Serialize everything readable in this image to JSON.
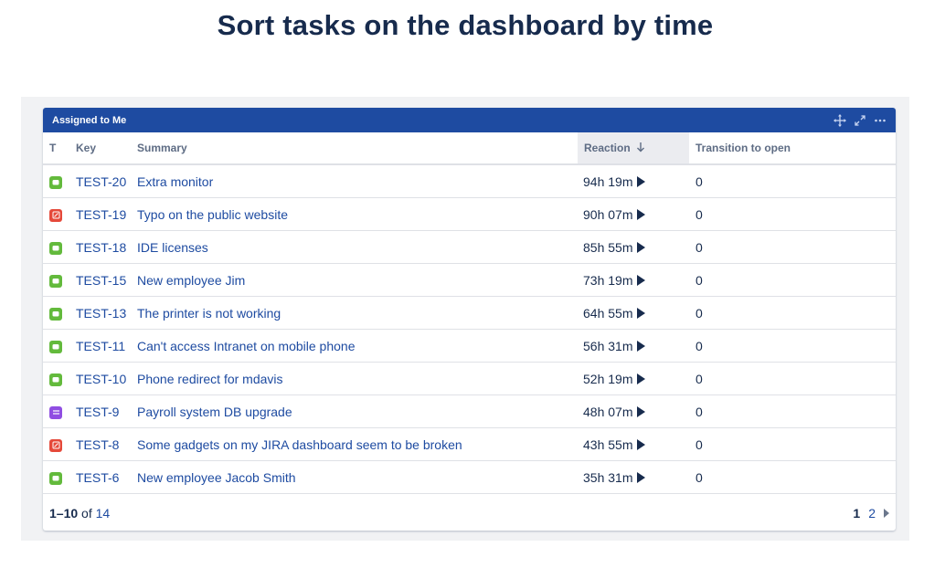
{
  "page": {
    "title": "Sort tasks on the dashboard by time"
  },
  "gadget": {
    "title": "Assigned to Me",
    "actions": [
      "move-icon",
      "expand-icon",
      "more-icon"
    ]
  },
  "table": {
    "columns": {
      "type": "T",
      "key": "Key",
      "summary": "Summary",
      "reaction": "Reaction",
      "transition": "Transition to open"
    },
    "sort": {
      "column": "reaction",
      "direction": "descending"
    },
    "rows": [
      {
        "type": "service-request",
        "key": "TEST-20",
        "summary": "Extra monitor",
        "reaction": "94h 19m",
        "transition": "0"
      },
      {
        "type": "incident",
        "key": "TEST-19",
        "summary": "Typo on the public website",
        "reaction": "90h 07m",
        "transition": "0"
      },
      {
        "type": "service-request",
        "key": "TEST-18",
        "summary": "IDE licenses",
        "reaction": "85h 55m",
        "transition": "0"
      },
      {
        "type": "service-request",
        "key": "TEST-15",
        "summary": "New employee Jim",
        "reaction": "73h 19m",
        "transition": "0"
      },
      {
        "type": "service-request",
        "key": "TEST-13",
        "summary": "The printer is not working",
        "reaction": "64h 55m",
        "transition": "0"
      },
      {
        "type": "service-request",
        "key": "TEST-11",
        "summary": "Can't access Intranet on mobile phone",
        "reaction": "56h 31m",
        "transition": "0"
      },
      {
        "type": "service-request",
        "key": "TEST-10",
        "summary": "Phone redirect for mdavis",
        "reaction": "52h 19m",
        "transition": "0"
      },
      {
        "type": "change",
        "key": "TEST-9",
        "summary": "Payroll system DB upgrade",
        "reaction": "48h 07m",
        "transition": "0"
      },
      {
        "type": "incident",
        "key": "TEST-8",
        "summary": "Some gadgets on my JIRA dashboard seem to be broken",
        "reaction": "43h 55m",
        "transition": "0"
      },
      {
        "type": "service-request",
        "key": "TEST-6",
        "summary": "New employee Jacob Smith",
        "reaction": "35h 31m",
        "transition": "0"
      }
    ]
  },
  "type_colors": {
    "service-request": "#63ba3c",
    "incident": "#e5493a",
    "change": "#904ee2"
  },
  "accent": "#1e4ba1",
  "footer": {
    "range": "1–10",
    "of_label": "of",
    "total": "14",
    "pages": [
      "1",
      "2"
    ],
    "current_page": "1"
  }
}
